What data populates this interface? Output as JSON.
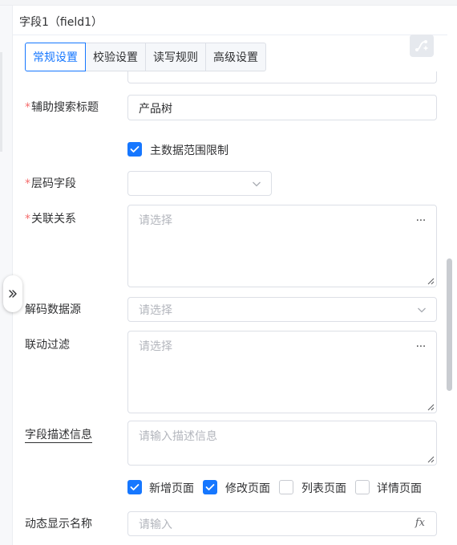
{
  "panel": {
    "title": "字段1（field1）"
  },
  "tabs": [
    {
      "label": "常规设置",
      "active": true
    },
    {
      "label": "校验设置",
      "active": false
    },
    {
      "label": "读写规则",
      "active": false
    },
    {
      "label": "高级设置",
      "active": false
    }
  ],
  "form": {
    "aux_search_title": {
      "label": "辅助搜索标题",
      "required": true,
      "value": "产品树"
    },
    "master_data_range": {
      "label": "主数据范围限制",
      "checked": true
    },
    "level_code_field": {
      "label": "层码字段",
      "required": true,
      "value": ""
    },
    "relation": {
      "label": "关联关系",
      "required": true,
      "placeholder": "请选择",
      "more": "···"
    },
    "decode_source": {
      "label": "解码数据源",
      "placeholder": "请选择"
    },
    "linkage_filter": {
      "label": "联动过滤",
      "placeholder": "请选择",
      "more": "···"
    },
    "field_desc": {
      "label": "字段描述信息",
      "placeholder": "请输入描述信息"
    },
    "pages": [
      {
        "label": "新增页面",
        "checked": true
      },
      {
        "label": "修改页面",
        "checked": true
      },
      {
        "label": "列表页面",
        "checked": false
      },
      {
        "label": "详情页面",
        "checked": false
      }
    ],
    "dynamic_name": {
      "label": "动态显示名称",
      "placeholder": "请输入",
      "fx": "fx"
    }
  },
  "icons": {
    "collapse": "double-chevron-right-icon",
    "corner": "connector-icon"
  },
  "colors": {
    "accent": "#1677ff",
    "required": "#f56c6c",
    "border": "#dcdfe6",
    "placeholder": "#b3b6bd"
  }
}
